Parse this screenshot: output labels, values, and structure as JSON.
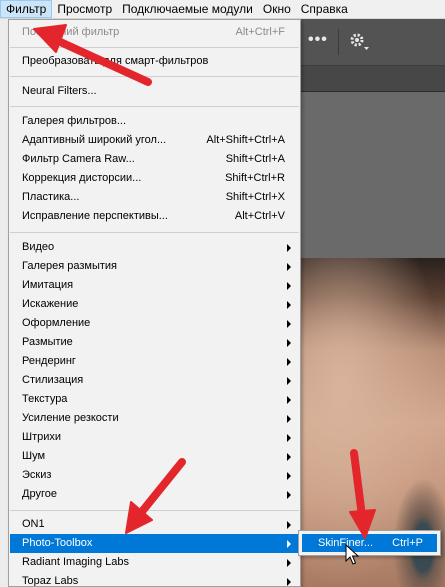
{
  "menubar": {
    "items": [
      "Фильтр",
      "Просмотр",
      "Подключаемые модули",
      "Окно",
      "Справка"
    ]
  },
  "menu": {
    "last_filter": {
      "label": "Последний фильтр",
      "shortcut": "Alt+Ctrl+F"
    },
    "convert_smart": {
      "label": "Преобразовать для смарт-фильтров"
    },
    "neural_filters": {
      "label": "Neural Filters..."
    },
    "group2": [
      {
        "label": "Галерея фильтров...",
        "shortcut": ""
      },
      {
        "label": "Адаптивный широкий угол...",
        "shortcut": "Alt+Shift+Ctrl+A"
      },
      {
        "label": "Фильтр Camera Raw...",
        "shortcut": "Shift+Ctrl+A"
      },
      {
        "label": "Коррекция дисторсии...",
        "shortcut": "Shift+Ctrl+R"
      },
      {
        "label": "Пластика...",
        "shortcut": "Shift+Ctrl+X"
      },
      {
        "label": "Исправление перспективы...",
        "shortcut": "Alt+Ctrl+V"
      }
    ],
    "submenus": [
      "Видео",
      "Галерея размытия",
      "Имитация",
      "Искажение",
      "Оформление",
      "Размытие",
      "Рендеринг",
      "Стилизация",
      "Текстура",
      "Усиление резкости",
      "Штрихи",
      "Шум",
      "Эскиз",
      "Другое"
    ],
    "plugins": [
      "ON1",
      "Photo-Toolbox",
      "Radiant Imaging Labs",
      "Topaz Labs"
    ]
  },
  "submenu": {
    "label": "SkinFiner...",
    "shortcut": "Ctrl+P"
  },
  "toolbar": {
    "more": "•••"
  },
  "colors": {
    "highlight": "#0078d7",
    "annotation_arrow": "#e3262c",
    "menu_bg": "#f2f2f2"
  }
}
